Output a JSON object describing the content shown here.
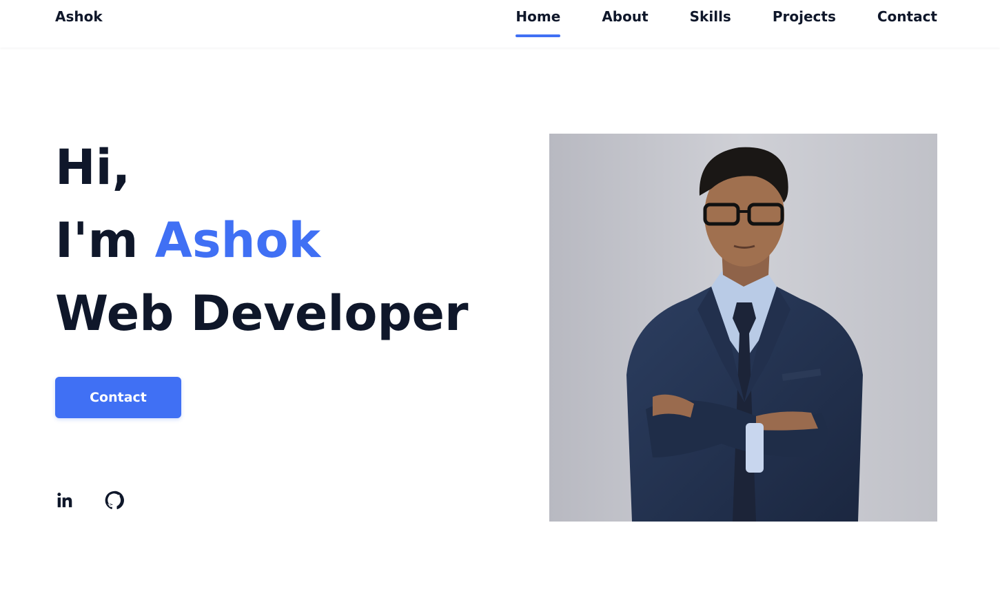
{
  "header": {
    "logo": "Ashok",
    "nav": [
      {
        "label": "Home",
        "active": true
      },
      {
        "label": "About",
        "active": false
      },
      {
        "label": "Skills",
        "active": false
      },
      {
        "label": "Projects",
        "active": false
      },
      {
        "label": "Contact",
        "active": false
      }
    ]
  },
  "hero": {
    "greeting": "Hi,",
    "intro_prefix": "I'm ",
    "name": "Ashok",
    "role": "Web Developer",
    "button_label": "Contact"
  },
  "social": [
    {
      "icon": "linkedin-icon"
    },
    {
      "icon": "github-icon"
    }
  ],
  "colors": {
    "accent": "#4070f4",
    "text": "#0f172a",
    "background": "#ffffff"
  }
}
